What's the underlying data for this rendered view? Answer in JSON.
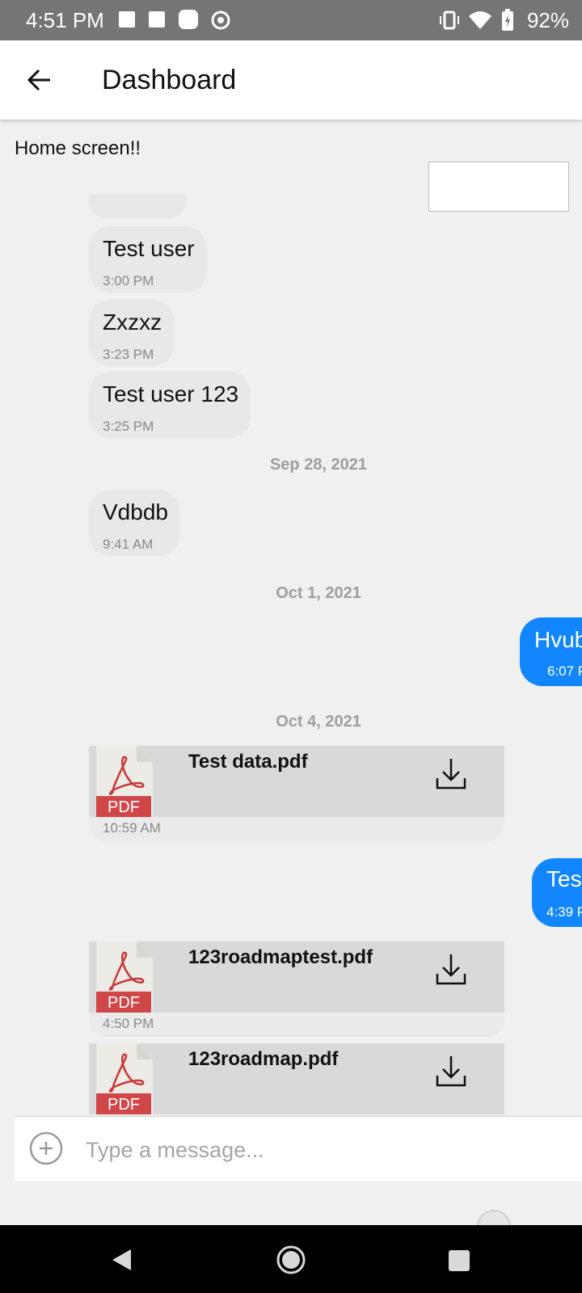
{
  "status_bar": {
    "time": "4:51 PM",
    "battery": "92%"
  },
  "header": {
    "title": "Dashboard"
  },
  "home_text": "Home screen!!",
  "messages_in": [
    {
      "text": "Test user",
      "time": "3:00 PM"
    },
    {
      "text": "Zxzxz",
      "time": "3:23 PM"
    },
    {
      "text": "Test user 123",
      "time": "3:25 PM"
    },
    {
      "text": "Vdbdb",
      "time": "9:41 AM"
    }
  ],
  "dates": [
    "Sep 28, 2021",
    "Oct 1, 2021",
    "Oct 4, 2021"
  ],
  "messages_out": [
    {
      "text": "Hvub",
      "time": "6:07 P"
    },
    {
      "text": "Tes",
      "time": "4:39 P"
    }
  ],
  "attachments": [
    {
      "name": "Test data.pdf",
      "time": "10:59 AM",
      "badge": "PDF"
    },
    {
      "name": "123roadmaptest.pdf",
      "time": "4:50 PM",
      "badge": "PDF"
    },
    {
      "name": "123roadmap.pdf",
      "time": "",
      "badge": "PDF"
    }
  ],
  "composer": {
    "placeholder": "Type a message..."
  },
  "colors": {
    "accent": "#1186ff",
    "pdf_red": "#d0474a"
  }
}
